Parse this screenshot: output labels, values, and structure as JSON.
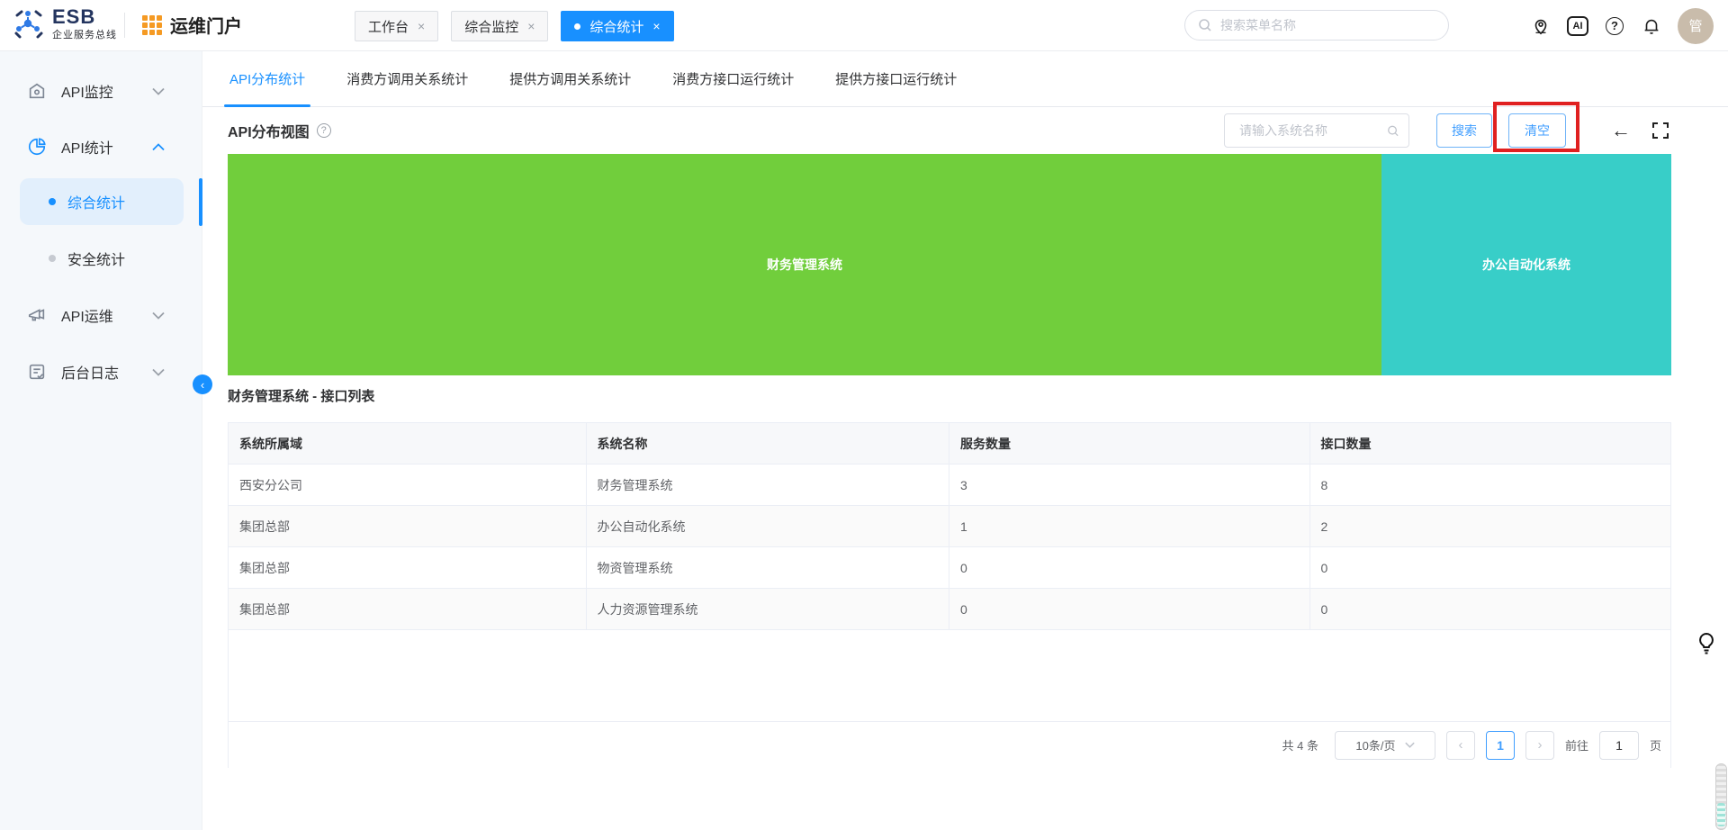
{
  "colors": {
    "accent_blue": "#1890ff",
    "button_blue": "#409eff",
    "treemap_green": "#71ce3c",
    "treemap_teal": "#38cec8",
    "annotation_red": "#e02020",
    "avatar_bg": "#c9bcab",
    "sidebar_bg": "#f5f8fb"
  },
  "glyphs": {
    "close": "×",
    "back_arrow": "←",
    "prev": "‹",
    "next": "›",
    "help": "?",
    "ai": "AI",
    "collapse": "‹"
  },
  "header": {
    "brand": "ESB",
    "brand_subtitle": "企业服务总线",
    "portal_title": "运维门户",
    "window_tabs": [
      {
        "label": "工作台",
        "active": false
      },
      {
        "label": "综合监控",
        "active": false
      },
      {
        "label": "综合统计",
        "active": true
      }
    ],
    "search_placeholder": "搜索菜单名称",
    "avatar_text": "管",
    "icon_names": [
      "location-icon",
      "ai-icon",
      "help-icon",
      "bell-icon",
      "avatar"
    ]
  },
  "sidebar": {
    "items": [
      {
        "label": "API监控",
        "icon": "monitor-icon",
        "expanded": false
      },
      {
        "label": "API统计",
        "icon": "pie-icon",
        "expanded": true
      },
      {
        "label": "API运维",
        "icon": "ops-icon",
        "expanded": false
      },
      {
        "label": "后台日志",
        "icon": "log-icon",
        "expanded": false
      }
    ],
    "sub_items": [
      {
        "label": "综合统计",
        "active": true
      },
      {
        "label": "安全统计",
        "active": false
      }
    ]
  },
  "main": {
    "tabs": [
      {
        "label": "API分布统计",
        "active": true
      },
      {
        "label": "消费方调用关系统计",
        "active": false
      },
      {
        "label": "提供方调用关系统计",
        "active": false
      },
      {
        "label": "消费方接口运行统计",
        "active": false
      },
      {
        "label": "提供方接口运行统计",
        "active": false
      }
    ],
    "panel_title": "API分布视图",
    "toolbar": {
      "input_placeholder": "请输入系统名称",
      "search_label": "搜索",
      "clear_label": "清空"
    },
    "treemap": {
      "blocks": [
        {
          "label": "财务管理系统",
          "color": "#71ce3c"
        },
        {
          "label": "办公自动化系统",
          "color": "#38cec8"
        }
      ]
    },
    "list_title": "财务管理系统 - 接口列表",
    "table": {
      "columns": [
        "系统所属域",
        "系统名称",
        "服务数量",
        "接口数量"
      ],
      "rows": [
        {
          "domain": "西安分公司",
          "name": "财务管理系统",
          "services": "3",
          "interfaces": "8"
        },
        {
          "domain": "集团总部",
          "name": "办公自动化系统",
          "services": "1",
          "interfaces": "2"
        },
        {
          "domain": "集团总部",
          "name": "物资管理系统",
          "services": "0",
          "interfaces": "0"
        },
        {
          "domain": "集团总部",
          "name": "人力资源管理系统",
          "services": "0",
          "interfaces": "0"
        }
      ]
    },
    "pagination": {
      "total_text": "共 4 条",
      "page_size": "10条/页",
      "current_page": "1",
      "goto_label": "前往",
      "goto_value": "1",
      "page_label": "页"
    }
  },
  "chart_data": {
    "type": "treemap",
    "title": "API分布视图",
    "items": [
      {
        "label": "财务管理系统",
        "interfaces": 8,
        "services": 3,
        "color": "#71ce3c",
        "width_share": 0.8
      },
      {
        "label": "办公自动化系统",
        "interfaces": 2,
        "services": 1,
        "color": "#38cec8",
        "width_share": 0.2
      }
    ],
    "note": "block widths proportional to interface counts 8:2"
  }
}
